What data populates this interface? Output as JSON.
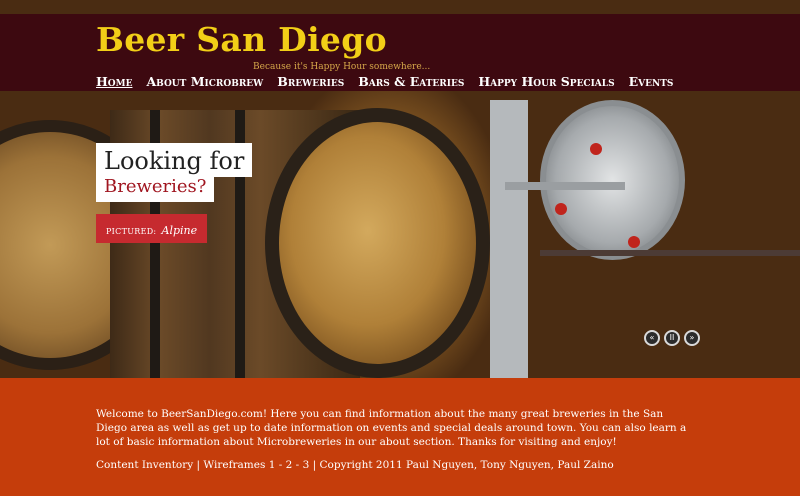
{
  "header": {
    "title": "Beer San Diego",
    "tagline": "Because it's Happy Hour somewhere..."
  },
  "nav": {
    "items": [
      {
        "label": "Home"
      },
      {
        "label": "About Microbrew"
      },
      {
        "label": "Breweries"
      },
      {
        "label": "Bars & Eateries"
      },
      {
        "label": "Happy Hour Specials"
      },
      {
        "label": "Events"
      }
    ],
    "active": "Home"
  },
  "hero": {
    "headline": "Looking for",
    "subheadline": "Breweries?",
    "pictured_label": "PICTURED:",
    "pictured_name": "Alpine",
    "controls": [
      {
        "icon": "previous-icon",
        "glyph": "«"
      },
      {
        "icon": "pause-icon",
        "glyph": "II"
      },
      {
        "icon": "next-icon",
        "glyph": "»"
      }
    ]
  },
  "footer": {
    "welcome": "Welcome to BeerSanDiego.com! Here you can find information about the many great breweries in the San Diego area as well as get up to date information on events and special deals around town. You can also learn a lot of basic information about Microbreweries in our about section. Thanks for visiting and enjoy!",
    "links": {
      "content_inventory": "Content Inventory",
      "sep1": "|",
      "wireframes": "Wireframes",
      "wf1": "1",
      "dash1": "-",
      "wf2": "2",
      "dash2": "-",
      "wf3": "3",
      "sep2": "|",
      "copyright": "Copyright 2011 Paul Nguyen, Tony Nguyen, Paul Zaino"
    }
  },
  "colors": {
    "header_bg": "#3c0610",
    "title": "#f2cf17",
    "footer_bg": "#c53d0b",
    "accent_red": "#c62a2f"
  }
}
